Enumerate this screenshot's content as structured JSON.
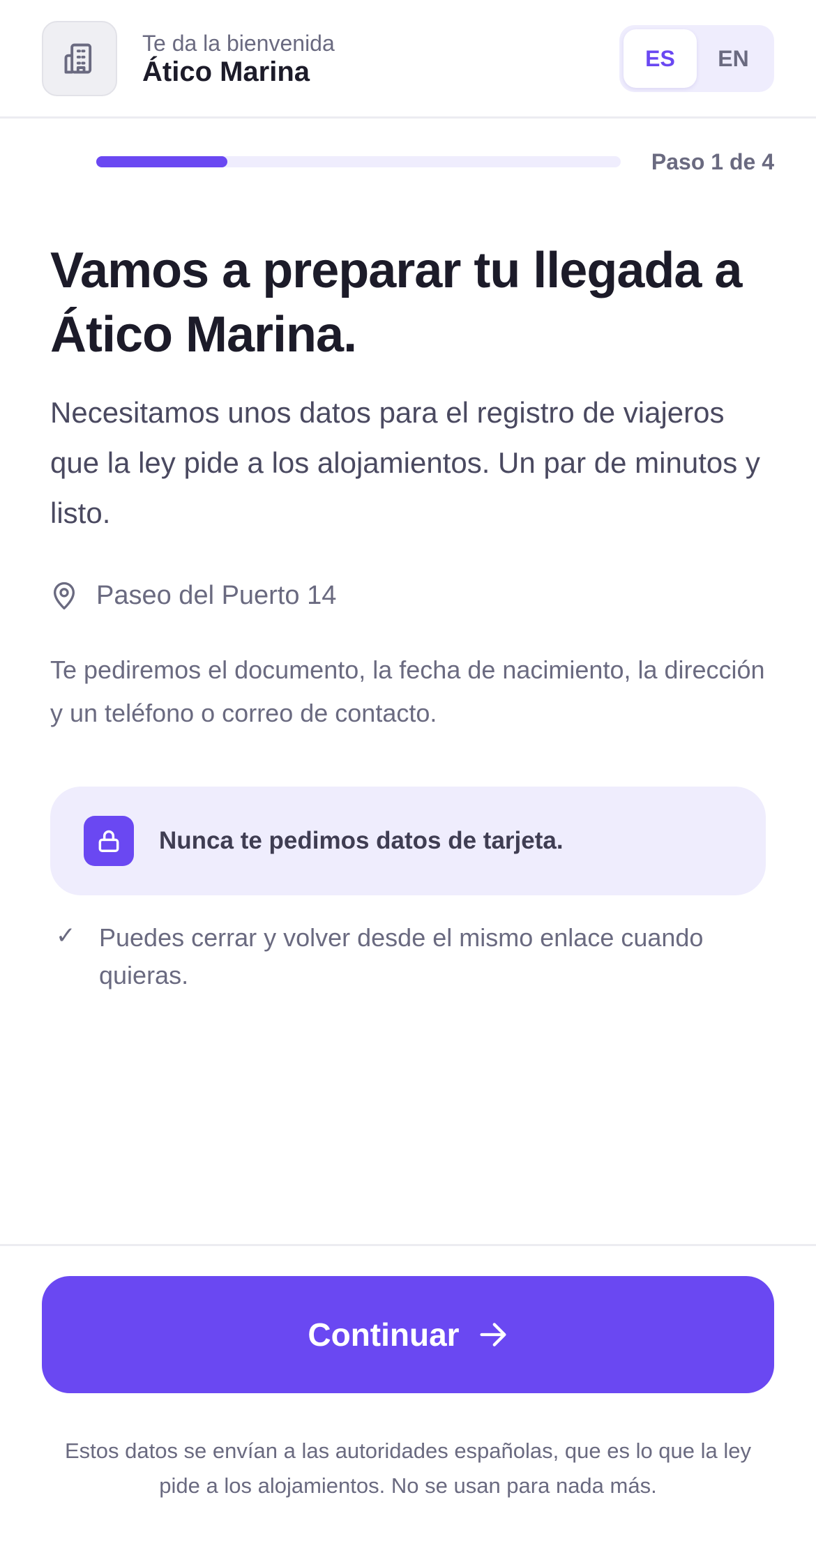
{
  "header": {
    "logo_icon": "building-icon",
    "welcome": "Te da la bienvenida",
    "hotel_name": "Ático Marina",
    "languages": [
      {
        "code": "ES",
        "active": true
      },
      {
        "code": "EN",
        "active": false
      }
    ]
  },
  "progress": {
    "fraction": 0.25,
    "label": "Paso 1 de 4"
  },
  "main": {
    "title": "Vamos a preparar tu llegada a Ático Marina.",
    "intro": "Necesitamos unos datos para el registro de viajeros que la ley pide a los alojamientos. Un par de minutos y listo.",
    "address_icon": "map-pin-icon",
    "address": "Paseo del Puerto 14",
    "details": "Te pediremos el documento, la fecha de nacimiento, la dirección y un teléfono o correo de contacto.",
    "notice_icon": "lock-icon",
    "notice": "Nunca te pedimos datos de tarjeta.",
    "tip_icon": "✓",
    "tip": "Puedes cerrar y volver desde el mismo enlace cuando quieras."
  },
  "footer": {
    "continue_label": "Continuar",
    "continue_icon": "arrow-right-icon",
    "legal": "Estos datos se envían a las autoridades españolas, que es lo que la ley pide a los alojamientos. No se usan para nada más."
  },
  "colors": {
    "accent": "#6a48f2",
    "accent_soft": "#efedfd",
    "text_dark": "#1c1b29",
    "text_muted": "#6a6a80"
  }
}
